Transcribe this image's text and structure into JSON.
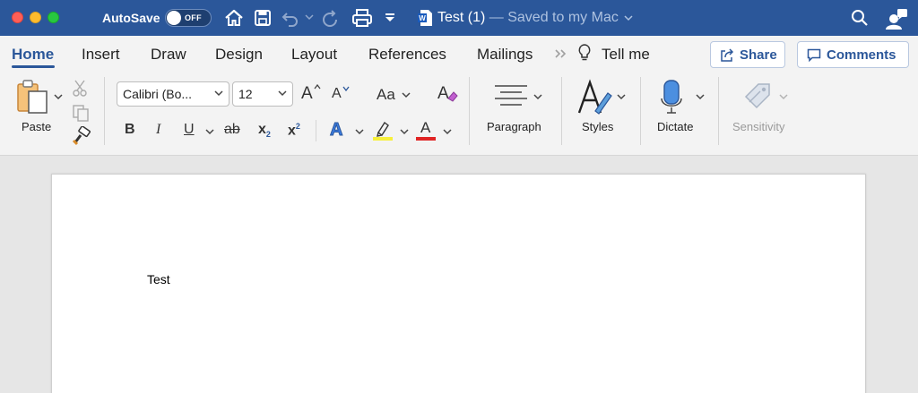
{
  "titlebar": {
    "autosave_label": "AutoSave",
    "autosave_state": "OFF",
    "doc_name": "Test (1)",
    "doc_status": " — Saved to my Mac",
    "bg_color": "#2b579a"
  },
  "tabs": {
    "items": [
      {
        "label": "Home"
      },
      {
        "label": "Insert"
      },
      {
        "label": "Draw"
      },
      {
        "label": "Design"
      },
      {
        "label": "Layout"
      },
      {
        "label": "References"
      },
      {
        "label": "Mailings"
      }
    ],
    "more_icon": "double-chevron-right-icon",
    "tell_me": "Tell me",
    "share": "Share",
    "comments": "Comments",
    "active": "Home"
  },
  "ribbon": {
    "paste_label": "Paste",
    "font_name": "Calibri (Bo...",
    "font_size": "12",
    "grow_font": "A",
    "shrink_font": "A",
    "change_case": "Aa",
    "bold": "B",
    "italic": "I",
    "underline": "U",
    "strikethrough": "ab",
    "subscript_base": "x",
    "subscript_mark": "2",
    "superscript_base": "x",
    "superscript_mark": "2",
    "text_effects": "A",
    "font_color": "A",
    "highlight_color": "#f7f03b",
    "font_color_value": "#e02424",
    "paragraph_label": "Paragraph",
    "styles_label": "Styles",
    "dictate_label": "Dictate",
    "sensitivity_label": "Sensitivity"
  },
  "document": {
    "body_text": "Test"
  }
}
